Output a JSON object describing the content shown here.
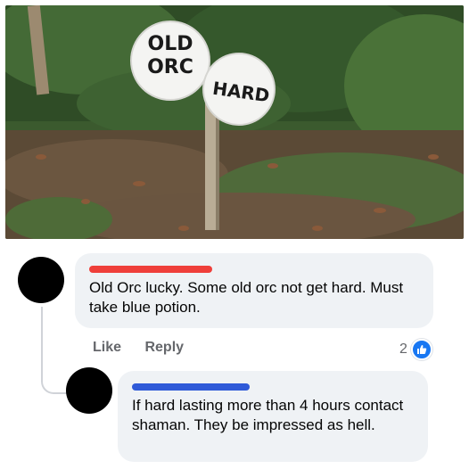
{
  "photo": {
    "sign_left_line1": "OLD",
    "sign_left_line2": "ORC",
    "sign_right": "HARD"
  },
  "comments": [
    {
      "author_redacted": true,
      "redaction_color": "#ef3f3a",
      "text": "Old Orc lucky. Some old orc not get hard. Must take blue potion.",
      "actions": {
        "like": "Like",
        "reply": "Reply"
      },
      "reaction_count": "2",
      "reaction_icon": "thumbs-up-icon"
    },
    {
      "author_redacted": true,
      "redaction_color": "#2f5ad8",
      "text": "If hard lasting more than 4 hours contact shaman. They be impressed as hell."
    }
  ]
}
